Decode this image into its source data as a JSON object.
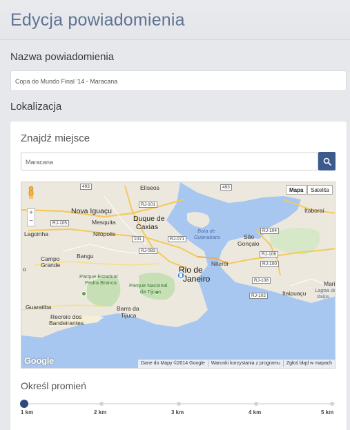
{
  "header": {
    "title": "Edycja powiadomienia"
  },
  "name_section": {
    "label": "Nazwa powiadomienia",
    "value": "Copa do Mundo Final '14 - Maracana"
  },
  "location_section": {
    "label": "Lokalizacja"
  },
  "location_card": {
    "title": "Znajdź miejsce",
    "search_value": "Maracana",
    "search_icon": "search-icon"
  },
  "map": {
    "type_buttons": [
      "Mapa",
      "Satelita"
    ],
    "active_type": "Mapa",
    "zoom_in": "+",
    "zoom_out": "−",
    "logo": "Google",
    "footer": [
      "Dane do Mapy ©2014 Google",
      "Warunki korzystania z programu",
      "Zgłoś błąd w mapach"
    ],
    "places": {
      "eliseos": "Elíseos",
      "nova_iguacu": "Nova Iguaçu",
      "duque": "Duque de",
      "caxias": "Caxias",
      "mesquita": "Mesquita",
      "nilopolis": "Nilópolis",
      "lagoinha": "Lagoinha",
      "bangu": "Bangu",
      "campo": "Campo",
      "grande": "Grande",
      "rio1": "Rio de",
      "rio2": "Janeiro",
      "niteroi": "Niterói",
      "sao1": "São",
      "sao2": "Gonçalo",
      "itaborai": "Itaboraí",
      "guaratiba": "Guaratiba",
      "recreio": "Recreio dos",
      "bandeirantes": "Bandeirantes",
      "barra1": "Barra da",
      "barra2": "Tijuca",
      "baia1": "Baía de",
      "baia2": "Guanabara",
      "lagoa1": "Lagoa de",
      "lagoa2": "Itaipu",
      "itaipuacu": "Itaipuaçu",
      "maric": "Maric",
      "parque1a": "Parque Estadual",
      "parque1b": "Pedra Branca",
      "parque2a": "Parque Nacional",
      "parque2b": "da Tijuca",
      "left_edge": "o"
    },
    "shields": [
      "RJ-101",
      "RJ-105",
      "RJ-071",
      "RJ-083",
      "RJ-104",
      "RJ-106",
      "RJ-100",
      "RJ-108",
      "RJ-102",
      "101",
      "493",
      "493"
    ]
  },
  "radius": {
    "label": "Określ promień",
    "value_km": 1,
    "ticks": [
      "1 km",
      "2 km",
      "3 km",
      "4 km",
      "5 km"
    ]
  },
  "colors": {
    "accent": "#3b5b8c",
    "title": "#5f7394",
    "water": "#a8c7f0",
    "land": "#ece8de"
  }
}
